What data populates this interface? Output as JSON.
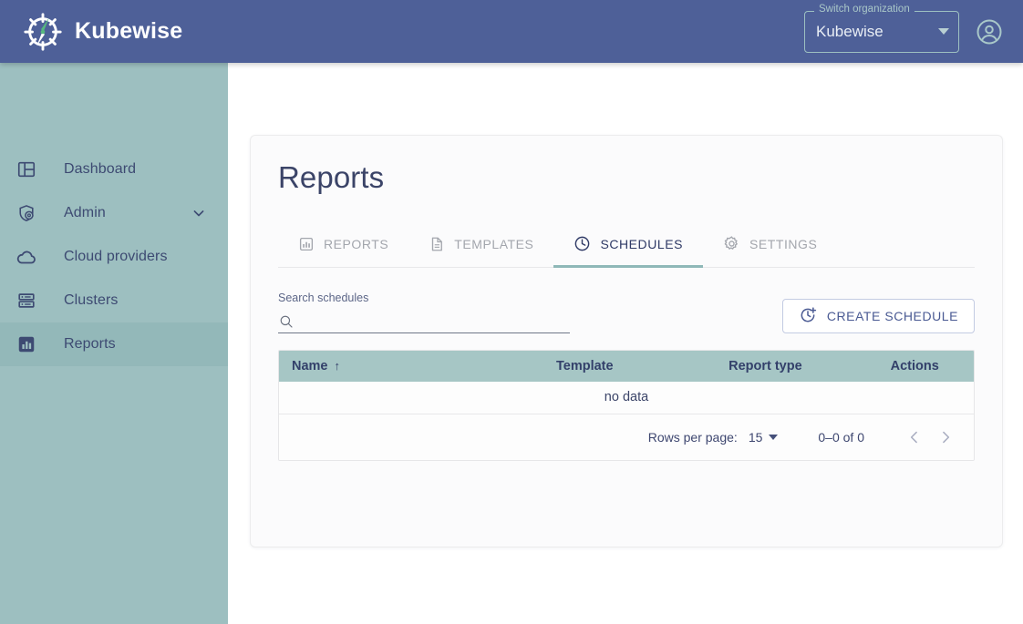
{
  "header": {
    "brand_name": "Kubewise",
    "brand_logo_icon": "compass-wheel-logo",
    "org_switcher": {
      "label": "Switch organization",
      "value": "Kubewise",
      "caret_icon": "chevron-down-icon"
    },
    "account_icon": "account-circle-icon"
  },
  "sidebar": {
    "items": [
      {
        "label": "Dashboard",
        "icon": "dashboard-layout-icon",
        "active": false,
        "expandable": false
      },
      {
        "label": "Admin",
        "icon": "admin-shield-icon",
        "active": false,
        "expandable": true
      },
      {
        "label": "Cloud providers",
        "icon": "cloud-icon",
        "active": false,
        "expandable": false
      },
      {
        "label": "Clusters",
        "icon": "server-racks-icon",
        "active": false,
        "expandable": false
      },
      {
        "label": "Reports",
        "icon": "bar-chart-icon",
        "active": true,
        "expandable": false
      }
    ]
  },
  "main": {
    "page_title": "Reports",
    "tabs": [
      {
        "label": "REPORTS",
        "icon": "bar-chart-icon",
        "active": false
      },
      {
        "label": "TEMPLATES",
        "icon": "document-icon",
        "active": false
      },
      {
        "label": "SCHEDULES",
        "icon": "clock-icon",
        "active": true
      },
      {
        "label": "SETTINGS",
        "icon": "gear-icon",
        "active": false
      }
    ],
    "toolbar": {
      "search_label": "Search schedules",
      "search_value": "",
      "search_placeholder": "",
      "search_icon": "search-icon",
      "create_button_label": "CREATE SCHEDULE",
      "create_button_icon": "clock-plus-icon"
    },
    "table": {
      "columns": [
        "Name",
        "Template",
        "Report type",
        "Actions"
      ],
      "sort_column": "Name",
      "sort_direction_icon": "arrow-up-icon",
      "rows": [],
      "empty_message": "no data"
    },
    "pagination": {
      "rows_per_page_label": "Rows per page:",
      "rows_per_page_value": "15",
      "range_label": "0–0 of 0",
      "prev_icon": "chevron-left-icon",
      "next_icon": "chevron-right-icon"
    }
  },
  "colors": {
    "header_blue": "#4e6098",
    "sidebar_teal": "#9dbfc0",
    "sidebar_active_teal": "#93b8b9",
    "table_header_teal": "#a6c6c5",
    "accent_navy": "#3b4468",
    "tab_underline_teal": "#8fb8b8"
  }
}
